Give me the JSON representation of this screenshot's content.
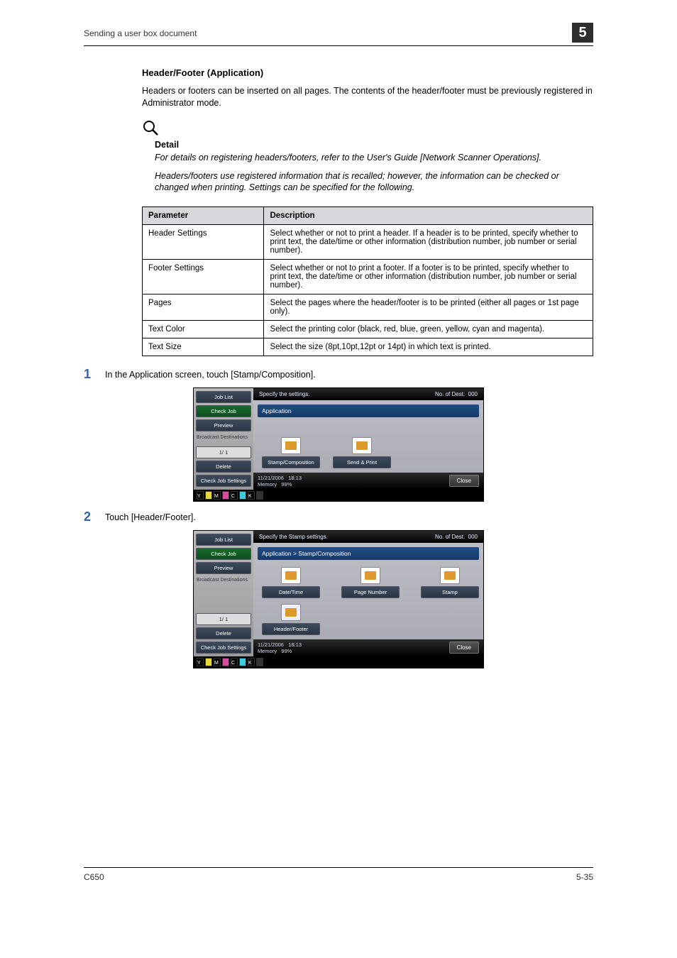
{
  "runningHead": "Sending a user box document",
  "chapterNumber": "5",
  "heading": "Header/Footer (Application)",
  "intro": "Headers or footers can be inserted on all pages. The contents of the header/footer must be previously registered in Administrator mode.",
  "detail": {
    "title": "Detail",
    "p1": "For details on registering headers/footers, refer to the User's Guide [Network Scanner Operations].",
    "p2": "Headers/footers use registered information that is recalled; however, the information can be checked or changed when printing. Settings can be specified for the following."
  },
  "table": {
    "headers": [
      "Parameter",
      "Description"
    ],
    "rows": [
      [
        "Header Settings",
        "Select whether or not to print a header. If a header is to be printed, specify whether to print text, the date/time or other information (distribution number, job number or serial number)."
      ],
      [
        "Footer Settings",
        "Select whether or not to print a footer. If a footer is to be printed, specify whether to print text, the date/time or other information (distribution number, job number or serial number)."
      ],
      [
        "Pages",
        "Select the pages where the header/footer is to be printed (either all pages or 1st page only)."
      ],
      [
        "Text Color",
        "Select the printing color (black, red, blue, green, yellow, cyan and magenta)."
      ],
      [
        "Text Size",
        "Select the size (8pt,10pt,12pt or 14pt) in which text is printed."
      ]
    ]
  },
  "step1": {
    "num": "1",
    "text": "In the Application screen, touch [Stamp/Composition]."
  },
  "step2": {
    "num": "2",
    "text": "Touch [Header/Footer]."
  },
  "device": {
    "jobList": "Job List",
    "checkJob": "Check Job",
    "preview": "Preview",
    "broadcast": "Broadcast\nDestinations",
    "pageInd": "1/  1",
    "delete": "Delete",
    "checkJobSettings": "Check Job\nSettings",
    "specify1": "Specify the settings.",
    "specify2": "Specify the Stamp settings.",
    "dest": "No. of\nDest.",
    "destCount": "000",
    "appBar1": "Application",
    "appBar2": "Application > Stamp/Composition",
    "btns1": [
      "Stamp/Composition",
      "Send & Print"
    ],
    "btns2": [
      "Date/Time",
      "Page Number",
      "Stamp",
      "Header/Footer"
    ],
    "close": "Close",
    "datetime": "11/21/2006",
    "time": "18:13",
    "memory": "Memory",
    "memPct": "99%"
  },
  "footer": {
    "left": "C650",
    "right": "5-35"
  }
}
